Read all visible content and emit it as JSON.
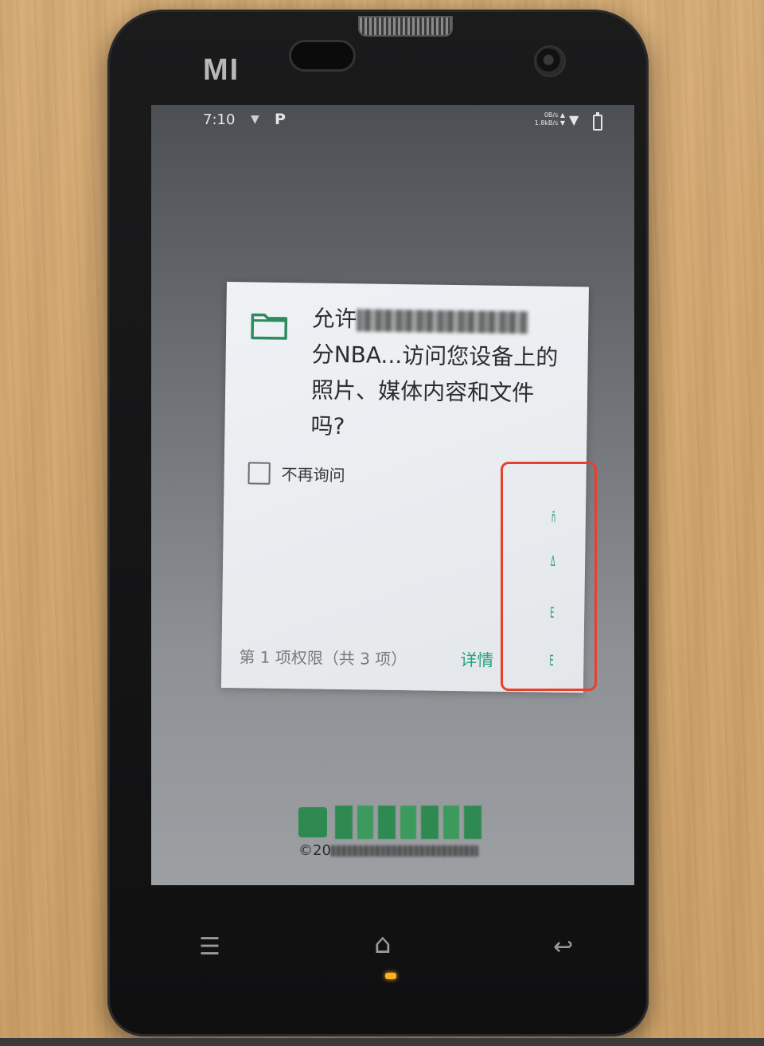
{
  "device": {
    "brand_logo": "MI"
  },
  "statusbar": {
    "time": "7:10",
    "notification_icon": "P",
    "upload_speed": "0B/s",
    "download_speed": "1.8kB/s"
  },
  "dialog": {
    "message_prefix": "允许",
    "message_suffix": "分NBA...访问您设备上的照片、媒体内容和文件吗?",
    "icon": "folder-icon",
    "checkbox_label": "不再询问",
    "checkbox_checked": false,
    "permission_count": "第 1 项权限（共 3 项）",
    "details_label": "详情",
    "accent_color": "#29a17d"
  },
  "splash": {
    "copyright_prefix": "©20"
  },
  "navigation": {
    "menu_icon": "menu-icon",
    "home_icon": "home-icon",
    "back_icon": "back-icon"
  },
  "annotation": {
    "highlight_color": "#e8402c"
  }
}
